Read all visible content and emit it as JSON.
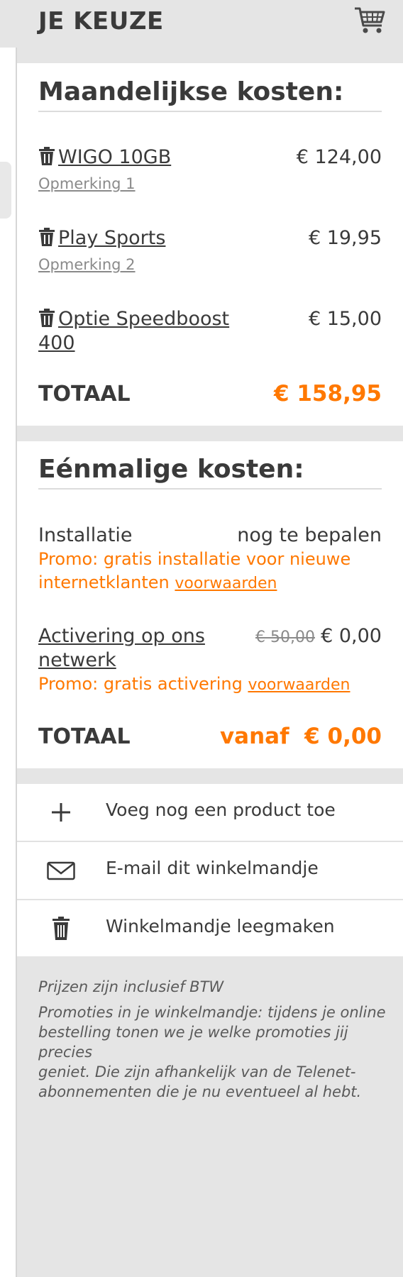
{
  "header": {
    "title": "JE KEUZE",
    "cart_icon": "shopping-cart-icon"
  },
  "monthly": {
    "title": "Maandelijkse kosten:",
    "items": [
      {
        "name": "WIGO 10GB",
        "price": "€ 124,00",
        "note": "Opmerking 1"
      },
      {
        "name": "Play Sports",
        "price": "€ 19,95",
        "note": "Opmerking 2"
      },
      {
        "name_line1": "Optie Speedboost",
        "name_line2": "400",
        "price": "€ 15,00"
      }
    ],
    "total_label": "TOTAAL",
    "total_value": "€ 158,95"
  },
  "onetime": {
    "title": "Eénmalige kosten:",
    "installation": {
      "label": "Installatie",
      "value": "nog te bepalen",
      "promo_line1": "Promo: gratis installatie voor nieuwe",
      "promo_line2": "internetklanten",
      "promo_link": "voorwaarden"
    },
    "activation": {
      "label_line1": "Activering op ons",
      "label_line2": "netwerk",
      "old_price": "€ 50,00",
      "price": "€ 0,00",
      "promo": "Promo: gratis activering",
      "promo_link": "voorwaarden"
    },
    "total_label": "TOTAAL",
    "total_value": "vanaf  € 0,00"
  },
  "actions": [
    {
      "icon": "plus-icon",
      "label": "Voeg nog een product toe"
    },
    {
      "icon": "envelope-icon",
      "label": "E-mail dit winkelmandje"
    },
    {
      "icon": "trash-icon",
      "label": "Winkelmandje leegmaken"
    }
  ],
  "footnotes": {
    "vat": "Prijzen zijn inclusief BTW",
    "promo_line1": "Promoties in je winkelmandje: tijdens je online",
    "promo_line2": "bestelling tonen we je welke promoties jij precies",
    "promo_line3": "geniet. Die zijn afhankelijk van de Telenet-",
    "promo_line4": "abonnementen die je nu eventueel al hebt."
  },
  "colors": {
    "accent": "#ff7800",
    "text": "#3a3a3a",
    "background": "#e5e5e5"
  }
}
